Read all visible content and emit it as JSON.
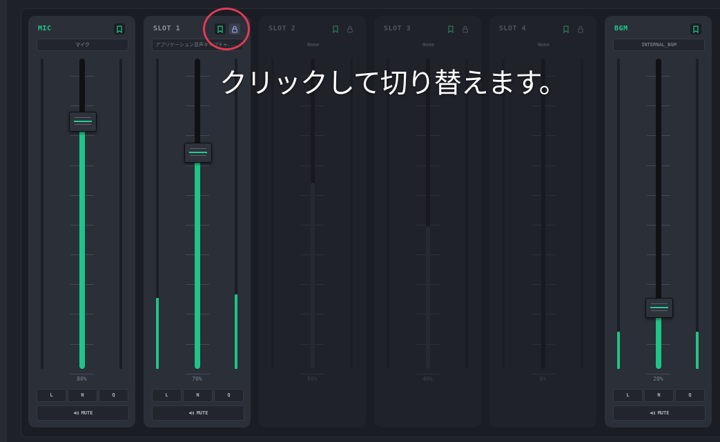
{
  "accent_color": "#1ec587",
  "highlight_color": "#e23a55",
  "caption": "クリックして切り替えます。",
  "channels": [
    {
      "title": "MIC",
      "source": "マイク",
      "level_percent": "80%",
      "level": 0.8,
      "meter_left": 0.0,
      "meter_right": 0.0,
      "active": true,
      "title_color": "green",
      "source_style": "box",
      "locked": null
    },
    {
      "title": "SLOT 1",
      "source": "アプリケーション音声キャプチャ...",
      "level_percent": "70%",
      "level": 0.7,
      "meter_left": 0.23,
      "meter_right": 0.24,
      "active": true,
      "title_color": "grey",
      "source_style": "left",
      "locked": false
    },
    {
      "title": "SLOT 2",
      "source": "None",
      "level_percent": "60%",
      "level": 0.6,
      "meter_left": 0,
      "meter_right": 0,
      "active": false,
      "title_color": "grey",
      "source_style": "plain",
      "locked": false
    },
    {
      "title": "SLOT 3",
      "source": "None",
      "level_percent": "46%",
      "level": 0.46,
      "meter_left": 0,
      "meter_right": 0,
      "active": false,
      "title_color": "grey",
      "source_style": "plain",
      "locked": false
    },
    {
      "title": "SLOT 4",
      "source": "None",
      "level_percent": "0%",
      "level": 0.0,
      "meter_left": 0,
      "meter_right": 0,
      "active": false,
      "title_color": "grey",
      "source_style": "plain",
      "locked": false
    },
    {
      "title": "BGM",
      "source": "INTERNAL_BGM",
      "level_percent": "20%",
      "level": 0.2,
      "meter_left": 0.12,
      "meter_right": 0.12,
      "active": true,
      "title_color": "green",
      "source_style": "box",
      "locked": null
    }
  ],
  "buttons": {
    "low": "L",
    "normal": "N",
    "quiet": "Q",
    "mute": "MUTE"
  },
  "icons": {
    "bookmark": "bookmark-icon",
    "lock": "lock-open-icon",
    "mute": "speaker-icon"
  }
}
